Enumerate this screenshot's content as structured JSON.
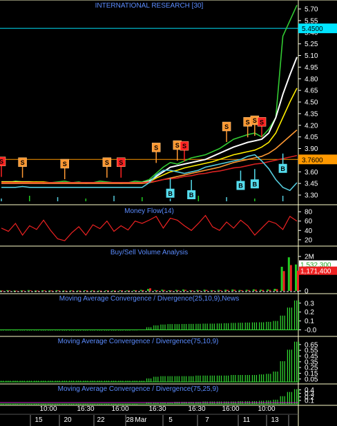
{
  "chart_data": [
    {
      "type": "line",
      "title": "INTERNATIONAL RESEARCH [30]",
      "y_ticks": [
        "5.70",
        "5.55",
        "5.40",
        "5.25",
        "5.10",
        "4.95",
        "4.80",
        "4.65",
        "4.50",
        "4.35",
        "4.20",
        "4.05",
        "3.90",
        "3.75",
        "3.60",
        "3.45",
        "3.30"
      ],
      "ylim": [
        3.22,
        5.78
      ],
      "grid": false,
      "reference_lines": [
        {
          "value": 5.45,
          "label": "5.4500",
          "color": "#00e5ff"
        },
        {
          "value": 3.76,
          "label": "3.7600",
          "color": "#ff9900"
        }
      ],
      "series": [
        {
          "color": "#33cc33",
          "values": [
            3.47,
            3.46,
            3.48,
            3.47,
            3.46,
            3.47,
            3.45,
            3.46,
            3.47,
            3.48,
            3.46,
            3.47,
            3.45,
            3.46,
            3.48,
            3.47,
            3.46,
            3.45,
            3.46,
            3.48,
            3.47,
            3.5,
            3.58,
            3.66,
            3.72,
            3.7,
            3.74,
            3.78,
            3.8,
            3.82,
            3.86,
            3.9,
            3.96,
            4.02,
            4.05,
            4.08,
            4.1,
            4.05,
            4.15,
            4.3,
            5.35,
            5.55,
            5.75
          ]
        },
        {
          "color": "#ffffff",
          "values": [
            3.47,
            3.47,
            3.47,
            3.47,
            3.47,
            3.46,
            3.46,
            3.46,
            3.46,
            3.46,
            3.46,
            3.46,
            3.46,
            3.46,
            3.46,
            3.46,
            3.46,
            3.46,
            3.46,
            3.46,
            3.46,
            3.48,
            3.54,
            3.6,
            3.66,
            3.68,
            3.7,
            3.72,
            3.74,
            3.76,
            3.8,
            3.84,
            3.88,
            3.92,
            3.95,
            3.98,
            4.0,
            4.02,
            4.1,
            4.3,
            4.6,
            4.85,
            5.08
          ]
        },
        {
          "color": "#ffee00",
          "values": [
            3.47,
            3.47,
            3.47,
            3.47,
            3.47,
            3.47,
            3.47,
            3.46,
            3.46,
            3.46,
            3.46,
            3.46,
            3.46,
            3.46,
            3.46,
            3.46,
            3.46,
            3.46,
            3.46,
            3.46,
            3.46,
            3.47,
            3.52,
            3.56,
            3.6,
            3.62,
            3.65,
            3.67,
            3.69,
            3.71,
            3.73,
            3.76,
            3.79,
            3.82,
            3.84,
            3.86,
            3.88,
            3.92,
            3.98,
            4.1,
            4.3,
            4.5,
            4.68
          ]
        },
        {
          "color": "#ff9933",
          "values": [
            3.45,
            3.45,
            3.45,
            3.45,
            3.45,
            3.45,
            3.45,
            3.45,
            3.45,
            3.45,
            3.45,
            3.45,
            3.45,
            3.45,
            3.45,
            3.45,
            3.45,
            3.45,
            3.45,
            3.45,
            3.45,
            3.46,
            3.48,
            3.5,
            3.52,
            3.54,
            3.56,
            3.58,
            3.6,
            3.62,
            3.64,
            3.66,
            3.69,
            3.72,
            3.74,
            3.76,
            3.78,
            3.8,
            3.84,
            3.9,
            3.98,
            4.06,
            4.14
          ]
        },
        {
          "color": "#dd2222",
          "values": [
            3.46,
            3.46,
            3.46,
            3.46,
            3.46,
            3.46,
            3.46,
            3.46,
            3.46,
            3.46,
            3.46,
            3.46,
            3.46,
            3.46,
            3.46,
            3.46,
            3.46,
            3.46,
            3.46,
            3.46,
            3.46,
            3.47,
            3.48,
            3.5,
            3.51,
            3.52,
            3.54,
            3.55,
            3.57,
            3.58,
            3.6,
            3.61,
            3.63,
            3.65,
            3.66,
            3.68,
            3.7,
            3.71,
            3.73,
            3.75,
            3.77,
            3.79,
            3.81
          ]
        },
        {
          "color": "#55ccdd",
          "values": [
            3.4,
            3.4,
            3.4,
            3.41,
            3.4,
            3.4,
            3.4,
            3.4,
            3.4,
            3.4,
            3.4,
            3.4,
            3.4,
            3.4,
            3.4,
            3.4,
            3.4,
            3.4,
            3.4,
            3.4,
            3.4,
            3.46,
            3.56,
            3.62,
            3.62,
            3.6,
            3.58,
            3.6,
            3.62,
            3.66,
            3.68,
            3.7,
            3.72,
            3.74,
            3.76,
            3.8,
            3.82,
            3.74,
            3.64,
            3.5,
            3.4,
            3.36,
            3.46
          ]
        }
      ],
      "sell_flags": [
        {
          "x": 0,
          "y": 3.73,
          "color": "#ff2222"
        },
        {
          "x": 3,
          "y": 3.72,
          "color": "#ff9933"
        },
        {
          "x": 9,
          "y": 3.7,
          "color": "#ff9933"
        },
        {
          "x": 15,
          "y": 3.72,
          "color": "#ff9933"
        },
        {
          "x": 17,
          "y": 3.72,
          "color": "#ff2222"
        },
        {
          "x": 22,
          "y": 3.91,
          "color": "#ff9933"
        },
        {
          "x": 25,
          "y": 3.94,
          "color": "#ff9933"
        },
        {
          "x": 26,
          "y": 3.93,
          "color": "#ff2222"
        },
        {
          "x": 32,
          "y": 4.18,
          "color": "#ff9933"
        },
        {
          "x": 35,
          "y": 4.24,
          "color": "#ff9933"
        },
        {
          "x": 36,
          "y": 4.26,
          "color": "#ff9933"
        },
        {
          "x": 37,
          "y": 4.24,
          "color": "#ff2222"
        }
      ],
      "buy_flags": [
        {
          "x": 24,
          "y": 3.32
        },
        {
          "x": 27,
          "y": 3.3
        },
        {
          "x": 34,
          "y": 3.42
        },
        {
          "x": 36,
          "y": 3.44
        },
        {
          "x": 40,
          "y": 3.64
        }
      ]
    },
    {
      "type": "line",
      "title": "Money Flow(14)",
      "y_ticks": [
        "80",
        "60",
        "40",
        "20"
      ],
      "ylim": [
        8,
        92
      ],
      "values": [
        45,
        38,
        55,
        30,
        50,
        42,
        62,
        40,
        22,
        18,
        35,
        48,
        30,
        52,
        44,
        60,
        38,
        50,
        41,
        60,
        55,
        62,
        70,
        45,
        66,
        62,
        50,
        40,
        55,
        72,
        48,
        40,
        58,
        45,
        62,
        50,
        30,
        45,
        60,
        55,
        42,
        70,
        60
      ]
    },
    {
      "type": "bar",
      "title": "Buy/Sell Volume Analysis",
      "y_ticks": [
        "2M",
        "0"
      ],
      "ylim": [
        0,
        2200000
      ],
      "value_labels": [
        {
          "value": 1532300,
          "label": "1,532,300",
          "color": "#22cc22"
        },
        {
          "value": 1171400,
          "label": "1,171,400",
          "color": "#ee2222"
        }
      ],
      "buy_values": [
        30000,
        45000,
        20000,
        35000,
        50000,
        25000,
        40000,
        30000,
        45000,
        20000,
        35000,
        25000,
        40000,
        30000,
        20000,
        35000,
        25000,
        40000,
        30000,
        45000,
        60000,
        110000,
        50000,
        70000,
        40000,
        60000,
        80000,
        40000,
        55000,
        70000,
        45000,
        60000,
        70000,
        80000,
        55000,
        65000,
        90000,
        70000,
        80000,
        120000,
        1400000,
        1950000,
        1532300
      ],
      "sell_values": [
        20000,
        30000,
        15000,
        25000,
        35000,
        20000,
        30000,
        25000,
        35000,
        15000,
        25000,
        20000,
        30000,
        25000,
        15000,
        30000,
        20000,
        35000,
        25000,
        35000,
        45000,
        150000,
        40000,
        55000,
        30000,
        45000,
        60000,
        30000,
        40000,
        55000,
        35000,
        45000,
        55000,
        65000,
        45000,
        50000,
        70000,
        55000,
        60000,
        100000,
        1150000,
        1500000,
        1171400
      ]
    },
    {
      "type": "bar",
      "title": "Moving Average Convergence / Divergence(25,10,9),News",
      "y_ticks": [
        "0.3",
        "0.2",
        "0.1",
        "-0.0"
      ],
      "ylim": [
        -0.05,
        0.36
      ],
      "values": [
        0,
        0,
        -0.002,
        -0.003,
        -0.004,
        -0.005,
        -0.006,
        -0.007,
        -0.007,
        -0.006,
        -0.005,
        -0.005,
        -0.006,
        -0.005,
        -0.004,
        -0.003,
        -0.002,
        -0.001,
        0.0,
        0.002,
        0.004,
        0.03,
        0.05,
        0.06,
        0.065,
        0.065,
        0.066,
        0.067,
        0.068,
        0.07,
        0.07,
        0.072,
        0.075,
        0.078,
        0.08,
        0.082,
        0.084,
        0.085,
        0.09,
        0.1,
        0.16,
        0.25,
        0.33
      ]
    },
    {
      "type": "bar",
      "title": "Moving Average Convergence / Divergence(75,10,9)",
      "y_ticks": [
        "0.65",
        "0.55",
        "0.45",
        "0.35",
        "0.25",
        "0.15",
        "0.05"
      ],
      "ylim": [
        0.0,
        0.72
      ],
      "values": [
        0.02,
        0.02,
        0.02,
        0.02,
        0.02,
        0.02,
        0.02,
        0.02,
        0.02,
        0.02,
        0.02,
        0.02,
        0.02,
        0.02,
        0.02,
        0.02,
        0.02,
        0.02,
        0.02,
        0.02,
        0.02,
        0.06,
        0.09,
        0.1,
        0.1,
        0.1,
        0.1,
        0.1,
        0.11,
        0.11,
        0.11,
        0.11,
        0.11,
        0.12,
        0.12,
        0.12,
        0.12,
        0.13,
        0.14,
        0.18,
        0.36,
        0.56,
        0.7
      ]
    },
    {
      "type": "bar",
      "title": "Moving Average Convergence / Divergence(75,25,9)",
      "y_ticks": [
        "0.4",
        "0.3",
        "0.2",
        "0.1"
      ],
      "ylim": [
        0.0,
        0.45
      ],
      "values": [
        0.0,
        0.0,
        0.0,
        0.0,
        0.0,
        0.0,
        0.0,
        0.0,
        0.0,
        0.0,
        0.0,
        0.0,
        0.0,
        0.0,
        0.0,
        0.0,
        0.0,
        0.0,
        0.0,
        0.0,
        0.01,
        0.03,
        0.04,
        0.05,
        0.05,
        0.06,
        0.06,
        0.06,
        0.06,
        0.07,
        0.07,
        0.07,
        0.07,
        0.07,
        0.08,
        0.08,
        0.08,
        0.09,
        0.1,
        0.12,
        0.22,
        0.34,
        0.42
      ]
    }
  ],
  "x_axis": {
    "top_row": [
      "10:00",
      "16:30",
      "16:00",
      "16:30",
      "16:30",
      "16:00",
      "10:00"
    ],
    "bottom_row": [
      "15",
      "20",
      "22",
      "28",
      "Mar",
      "5",
      "7",
      "11",
      "13"
    ]
  },
  "colors": {
    "background": "#000000",
    "divider": "#ffffcc",
    "axis_text": "#ffffff",
    "title_text": "#5b8cff",
    "buy": "#22cc22",
    "sell": "#ee2222"
  }
}
